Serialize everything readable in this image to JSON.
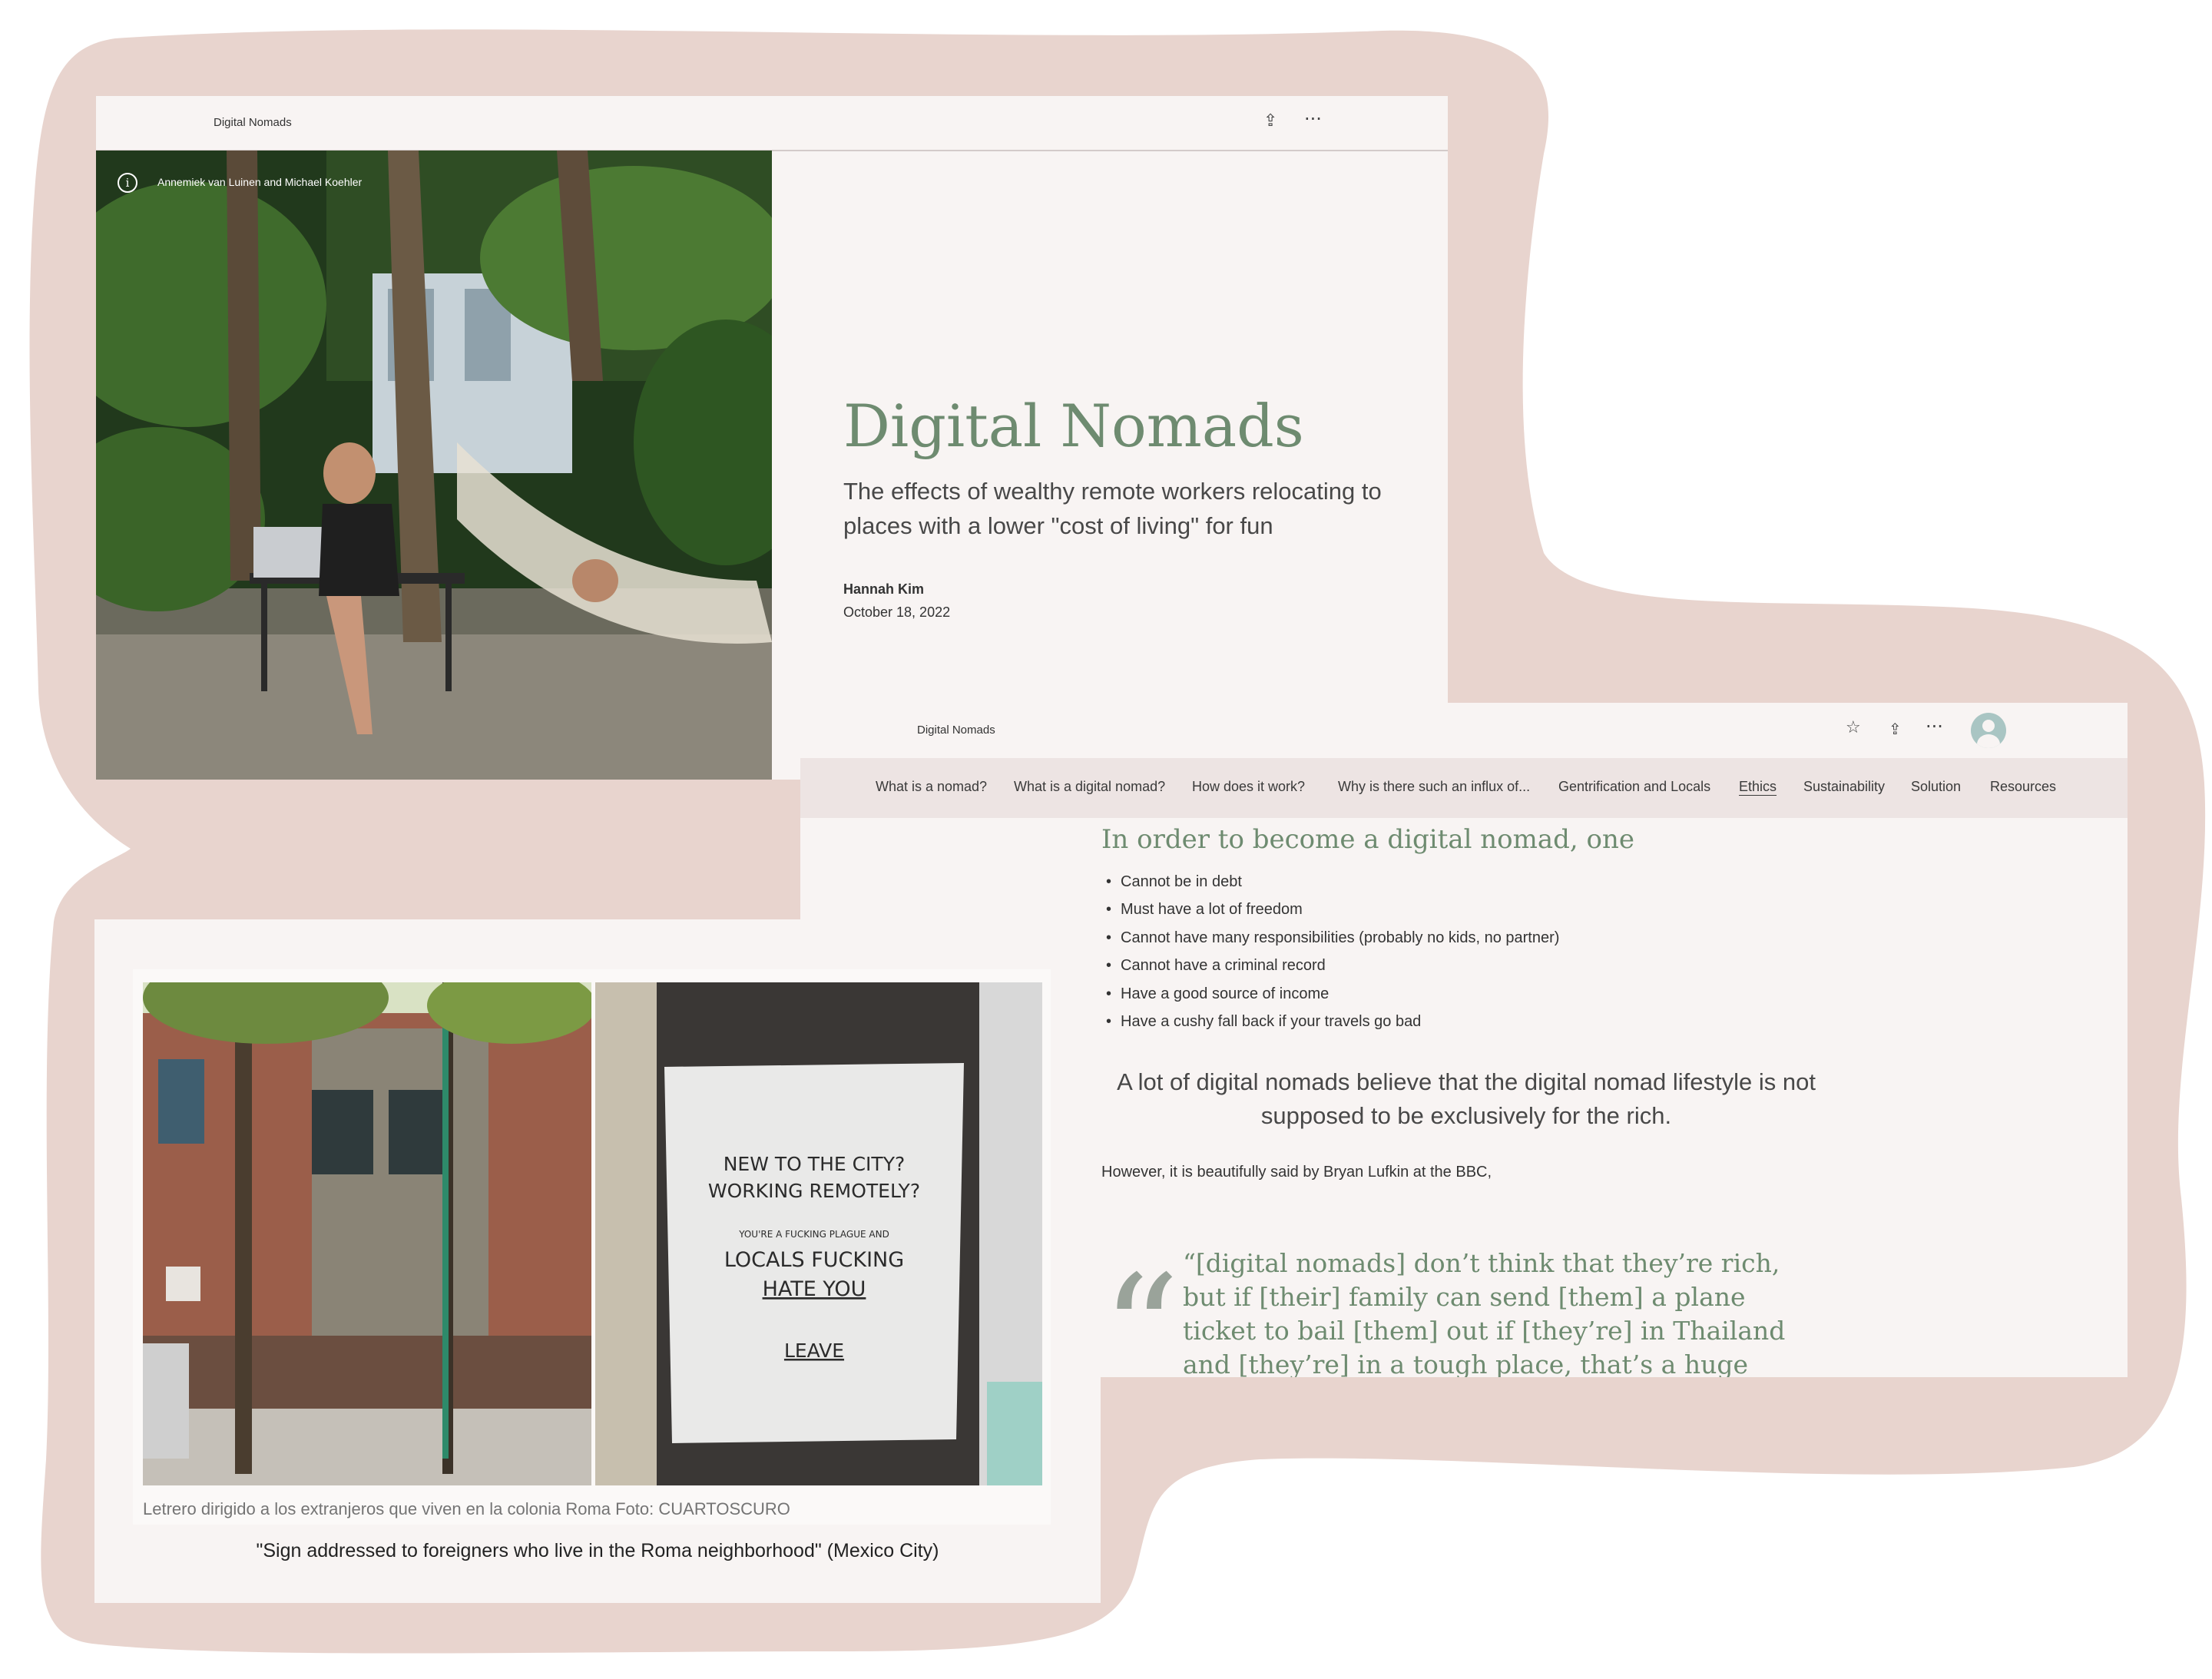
{
  "colors": {
    "background_blob": "#e8d4ce",
    "panel": "#f8f4f3",
    "accent_green": "#6e8b70",
    "nav_bar": "#ede4e3"
  },
  "hero": {
    "breadcrumb": "Digital Nomads",
    "share_icon": "share-icon",
    "more_icon": "more-options-icon",
    "photo_credit": "Annemiek van Luinen and Michael Koehler",
    "title": "Digital Nomads",
    "subtitle": "The effects of wealthy remote workers relocating to places with a lower \"cost of living\" for fun",
    "author": "Hannah Kim",
    "date": "October 18, 2022"
  },
  "article": {
    "breadcrumb": "Digital Nomads",
    "toolbar_icons": [
      "star-icon",
      "share-icon",
      "more-options-icon",
      "avatar"
    ],
    "nav": [
      "What is a nomad?",
      "What is a digital nomad?",
      "How does it work?",
      "Why is there such an influx of...",
      "Gentrification and Locals",
      "Ethics",
      "Sustainability",
      "Solution",
      "Resources"
    ],
    "active_nav": "Ethics",
    "heading": "In order to become a digital nomad, one",
    "bullets": [
      "Cannot be in debt",
      "Must have a lot of freedom",
      "Cannot have many responsibilities (probably no kids, no partner)",
      "Cannot have a criminal record",
      "Have a good source of income",
      "Have a cushy fall back if your travels go bad"
    ],
    "callout": "A lot of digital nomads believe that the digital nomad lifestyle is not supposed to be exclusively for the rich.",
    "lead_in": "However, it is beautifully said by Bryan Lufkin at the BBC,",
    "quote_mark": "“",
    "quote": "“[digital nomads] don’t think that they’re rich, but if [their] family can send [them] a plane ticket to bail [them] out if [they’re] in Thailand and [they’re] in a tough place, that’s a huge privilege.”"
  },
  "photo": {
    "sign_lines": [
      "NEW TO THE CITY?",
      "WORKING REMOTELY?",
      "YOU'RE A FUCKING PLAGUE AND",
      "LOCALS FUCKING",
      "HATE YOU",
      "LEAVE"
    ],
    "spanish_caption": "Letrero dirigido a los extranjeros que viven en la colonia Roma Foto: CUARTOSCURO",
    "caption": "\"Sign addressed to foreigners who live in the Roma neighborhood\" (Mexico City)"
  }
}
